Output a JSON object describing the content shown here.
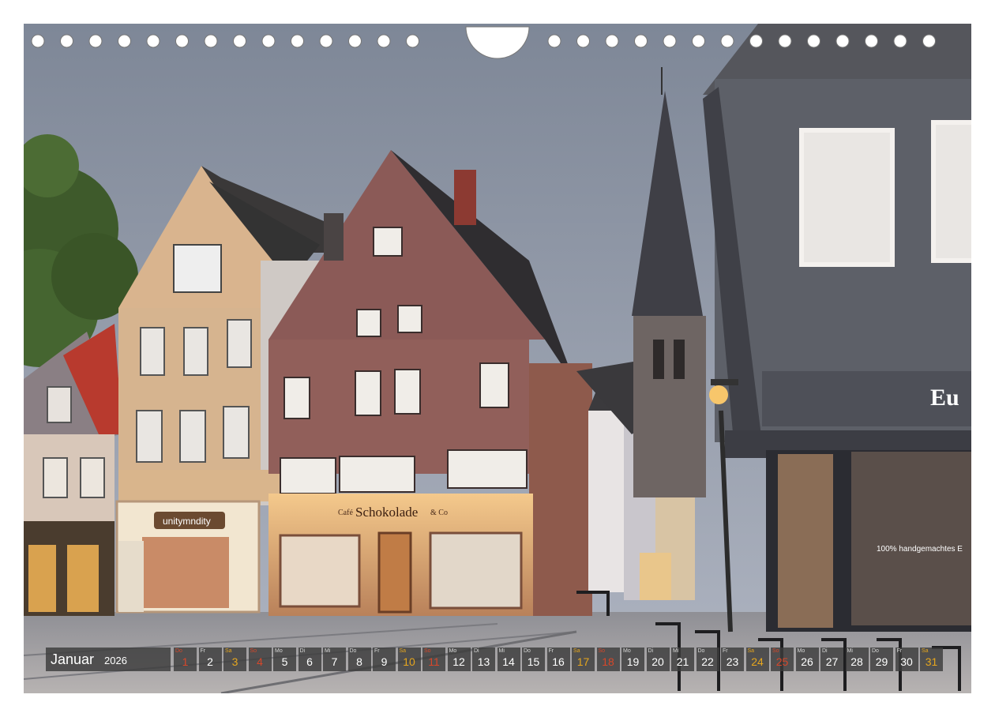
{
  "photo": {
    "sign_shop1": "unitymndity",
    "sign_shop2": "Schokolade",
    "sign_shop2_prefix": "Café",
    "sign_shop2_suffix": "& Co",
    "sign_right": "Eu",
    "window_text_right": "100% handgemachtes E"
  },
  "calendar": {
    "month": "Januar",
    "year": "2026",
    "colors": {
      "weekday": "#ffffff",
      "saturday": "#e6a61e",
      "sunday": "#d7472a",
      "cell_bg": "#3c3c3c"
    },
    "days": [
      {
        "dow": "Do",
        "num": "1",
        "type": "sun"
      },
      {
        "dow": "Fr",
        "num": "2",
        "type": "wd"
      },
      {
        "dow": "Sa",
        "num": "3",
        "type": "sat"
      },
      {
        "dow": "So",
        "num": "4",
        "type": "sun"
      },
      {
        "dow": "Mo",
        "num": "5",
        "type": "wd"
      },
      {
        "dow": "Di",
        "num": "6",
        "type": "wd"
      },
      {
        "dow": "Mi",
        "num": "7",
        "type": "wd"
      },
      {
        "dow": "Do",
        "num": "8",
        "type": "wd"
      },
      {
        "dow": "Fr",
        "num": "9",
        "type": "wd"
      },
      {
        "dow": "Sa",
        "num": "10",
        "type": "sat"
      },
      {
        "dow": "So",
        "num": "11",
        "type": "sun"
      },
      {
        "dow": "Mo",
        "num": "12",
        "type": "wd"
      },
      {
        "dow": "Di",
        "num": "13",
        "type": "wd"
      },
      {
        "dow": "Mi",
        "num": "14",
        "type": "wd"
      },
      {
        "dow": "Do",
        "num": "15",
        "type": "wd"
      },
      {
        "dow": "Fr",
        "num": "16",
        "type": "wd"
      },
      {
        "dow": "Sa",
        "num": "17",
        "type": "sat"
      },
      {
        "dow": "So",
        "num": "18",
        "type": "sun"
      },
      {
        "dow": "Mo",
        "num": "19",
        "type": "wd"
      },
      {
        "dow": "Di",
        "num": "20",
        "type": "wd"
      },
      {
        "dow": "Mi",
        "num": "21",
        "type": "wd"
      },
      {
        "dow": "Do",
        "num": "22",
        "type": "wd"
      },
      {
        "dow": "Fr",
        "num": "23",
        "type": "wd"
      },
      {
        "dow": "Sa",
        "num": "24",
        "type": "sat"
      },
      {
        "dow": "So",
        "num": "25",
        "type": "sun"
      },
      {
        "dow": "Mo",
        "num": "26",
        "type": "wd"
      },
      {
        "dow": "Di",
        "num": "27",
        "type": "wd"
      },
      {
        "dow": "Mi",
        "num": "28",
        "type": "wd"
      },
      {
        "dow": "Do",
        "num": "29",
        "type": "wd"
      },
      {
        "dow": "Fr",
        "num": "30",
        "type": "wd"
      },
      {
        "dow": "Sa",
        "num": "31",
        "type": "sat"
      }
    ]
  }
}
